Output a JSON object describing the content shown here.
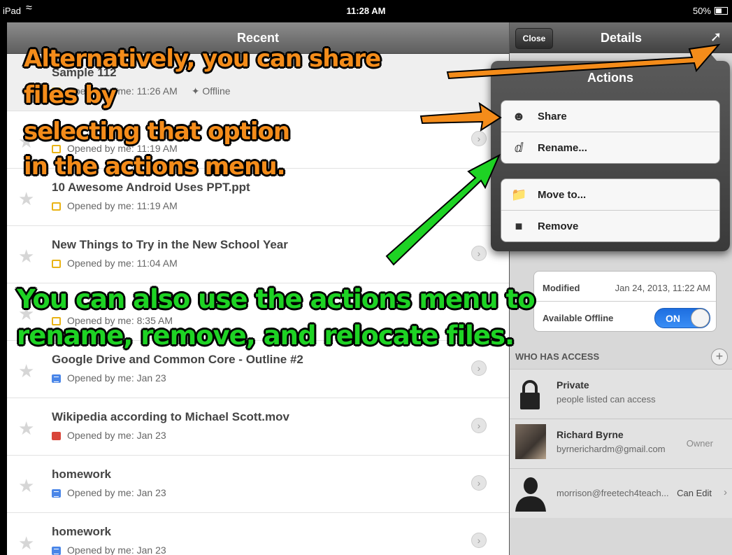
{
  "status_bar": {
    "carrier": "iPad",
    "time": "11:28 AM",
    "battery": "50%"
  },
  "left_pane": {
    "title": "Recent",
    "files": [
      {
        "title": "Sample 112",
        "meta": "Opened by me: 11:26 AM",
        "offline": "Offline",
        "icon": "slides-icon"
      },
      {
        "title": "",
        "meta": "Opened by me: 11:19 AM",
        "offline": "",
        "icon": "slides-icon"
      },
      {
        "title": "10 Awesome Android Uses PPT.ppt",
        "meta": "Opened by me: 11:19 AM",
        "offline": "",
        "icon": "slides-icon"
      },
      {
        "title": "New Things to Try in the New School Year",
        "meta": "Opened by me: 11:04 AM",
        "offline": "",
        "icon": "slides-icon"
      },
      {
        "title": "",
        "meta": "Opened by me: 8:35 AM",
        "offline": "",
        "icon": "slides-icon"
      },
      {
        "title": "Google Drive and Common Core - Outline #2",
        "meta": "Opened by me: Jan 23",
        "offline": "",
        "icon": "doc-icon"
      },
      {
        "title": "Wikipedia according to Michael Scott.mov",
        "meta": "Opened by me: Jan 23",
        "offline": "",
        "icon": "movie-icon"
      },
      {
        "title": "homework",
        "meta": "Opened by me: Jan 23",
        "offline": "",
        "icon": "doc-icon"
      },
      {
        "title": "homework",
        "meta": "Opened by me: Jan 23",
        "offline": "",
        "icon": "doc-icon"
      }
    ]
  },
  "right_pane": {
    "close_label": "Close",
    "title": "Details",
    "modified_label": "Modified",
    "modified_value": "Jan 24, 2013, 11:22 AM",
    "offline_label": "Available Offline",
    "offline_toggle": "ON",
    "access_header": "WHO HAS ACCESS",
    "access": [
      {
        "name": "Private",
        "detail": "people listed can access",
        "role": ""
      },
      {
        "name": "Richard Byrne",
        "detail": "byrnerichardm@gmail.com",
        "role": "Owner"
      },
      {
        "name": "",
        "detail": "morrison@freetech4teach...",
        "role": "Can Edit"
      }
    ]
  },
  "actions_popover": {
    "title": "Actions",
    "group1": [
      {
        "label": "Share",
        "icon": "add-person-icon"
      },
      {
        "label": "Rename...",
        "icon": "text-cursor-icon"
      }
    ],
    "group2": [
      {
        "label": "Move to...",
        "icon": "folder-move-icon"
      },
      {
        "label": "Remove",
        "icon": "trash-icon"
      }
    ]
  },
  "annotations": {
    "orange_lines": [
      "Alternatively, you can share",
      "files by",
      "selecting that option",
      "in the actions menu."
    ],
    "green_lines": [
      "You can also use the actions menu to",
      "rename, remove, and relocate files."
    ],
    "orange_color": "#f48c1a",
    "green_color": "#1ed324"
  }
}
